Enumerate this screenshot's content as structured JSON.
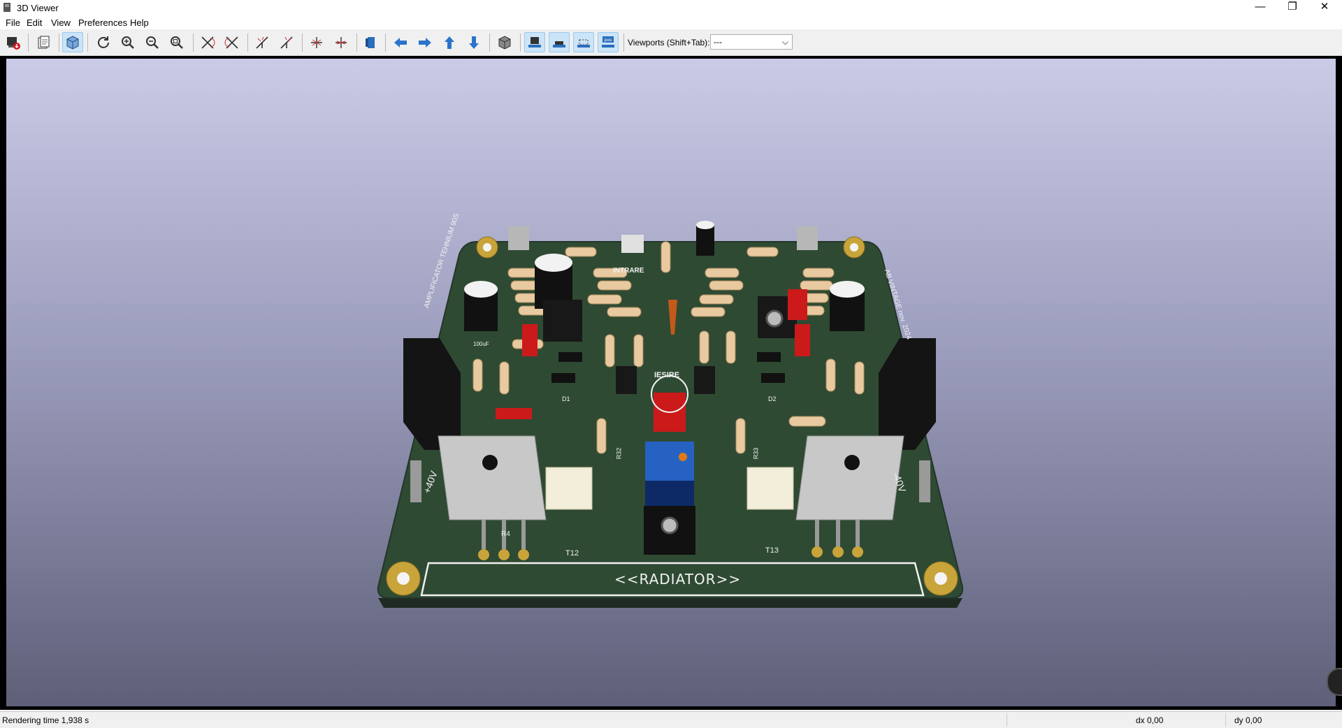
{
  "window": {
    "title": "3D Viewer",
    "min_label": "—",
    "max_label": "❐",
    "close_label": "✕"
  },
  "menu": [
    "File",
    "Edit",
    "View",
    "Preferences",
    "Help"
  ],
  "toolbar": {
    "viewports_label": "Viewports (Shift+Tab):",
    "viewports_value": "---",
    "layer_btn4_label": "pos"
  },
  "board": {
    "title_left": "AMPLIFICATOR TEHNIUM 90S",
    "title_right": "AB VINTAGE nov. 2024",
    "intrare": "INTRARE",
    "iesire": "IESIRE",
    "radiator": "<<RADIATOR>>",
    "plus_v": "+40V",
    "minus_v": "-40V",
    "t12": "T12",
    "t13": "T13",
    "r4": "R4",
    "d1": "D1",
    "d2": "D2",
    "r32": "R32",
    "r33": "R33",
    "c100": "100uF"
  },
  "status": {
    "render_time": "Rendering time 1,938 s",
    "dx": "dx 0,00",
    "dy": "dy 0,00"
  },
  "colors": {
    "pcb_green": "#2f4a33",
    "silk": "#f2f2f2",
    "pad_gold": "#c9a43a",
    "bg_top": "#cacbe6",
    "bg_bottom": "#5e6079"
  }
}
